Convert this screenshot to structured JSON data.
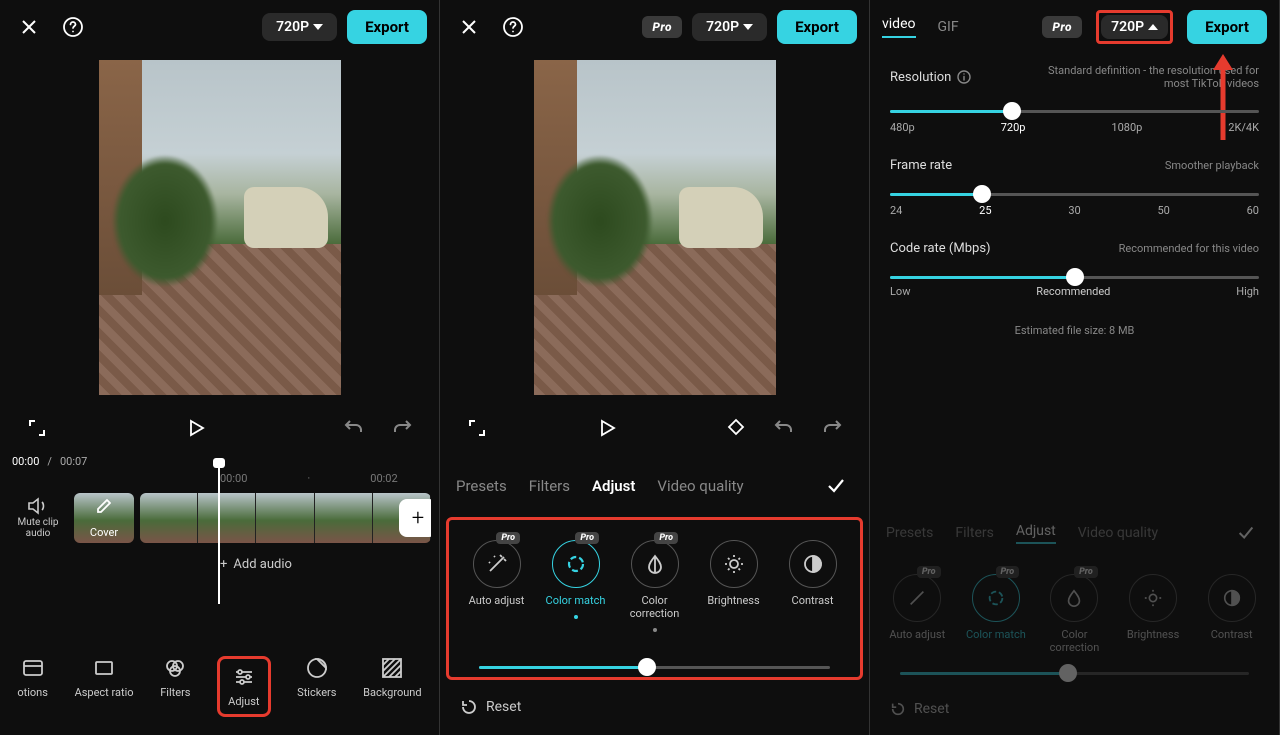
{
  "panel1": {
    "resolution_label": "720P",
    "export_label": "Export",
    "time_current": "00:00",
    "time_total": "00:07",
    "ruler": [
      "00:00",
      "00:02"
    ],
    "mute_label": "Mute clip audio",
    "cover_label": "Cover",
    "add_audio_label": "Add audio",
    "tools": {
      "options": "otions",
      "aspect": "Aspect ratio",
      "filters": "Filters",
      "adjust": "Adjust",
      "stickers": "Stickers",
      "background": "Background"
    }
  },
  "panel2": {
    "pro_label": "Pro",
    "resolution_label": "720P",
    "export_label": "Export",
    "tabs": {
      "presets": "Presets",
      "filters": "Filters",
      "adjust": "Adjust",
      "video_quality": "Video quality"
    },
    "adjust": {
      "auto": "Auto adjust",
      "match": "Color match",
      "correction": "Color correction",
      "brightness": "Brightness",
      "contrast": "Contrast",
      "pro_badge": "Pro"
    },
    "slider_value_pct": 48,
    "reset_label": "Reset"
  },
  "panel3": {
    "tab_video": "video",
    "tab_gif": "GIF",
    "pro_label": "Pro",
    "resolution_label": "720P",
    "export_label": "Export",
    "resolution": {
      "label": "Resolution",
      "hint": "Standard definition - the resolution used for most TikTok videos",
      "ticks": [
        "480p",
        "720p",
        "1080p",
        "2K/4K"
      ],
      "value_pct": 33
    },
    "framerate": {
      "label": "Frame rate",
      "hint": "Smoother playback",
      "ticks": [
        "24",
        "25",
        "30",
        "50",
        "60"
      ],
      "value_pct": 25
    },
    "coderate": {
      "label": "Code rate (Mbps)",
      "hint": "Recommended for this video",
      "low": "Low",
      "mid": "Recommended",
      "high": "High",
      "value_pct": 50
    },
    "estimated": "Estimated file size: 8 MB",
    "dim_tabs": {
      "presets": "Presets",
      "filters": "Filters",
      "adjust": "Adjust",
      "video_quality": "Video quality"
    },
    "dim_adjust": {
      "auto": "Auto adjust",
      "match": "Color match",
      "correction": "Color correction",
      "brightness": "Brightness",
      "contrast": "Contrast"
    },
    "dim_reset": "Reset"
  }
}
